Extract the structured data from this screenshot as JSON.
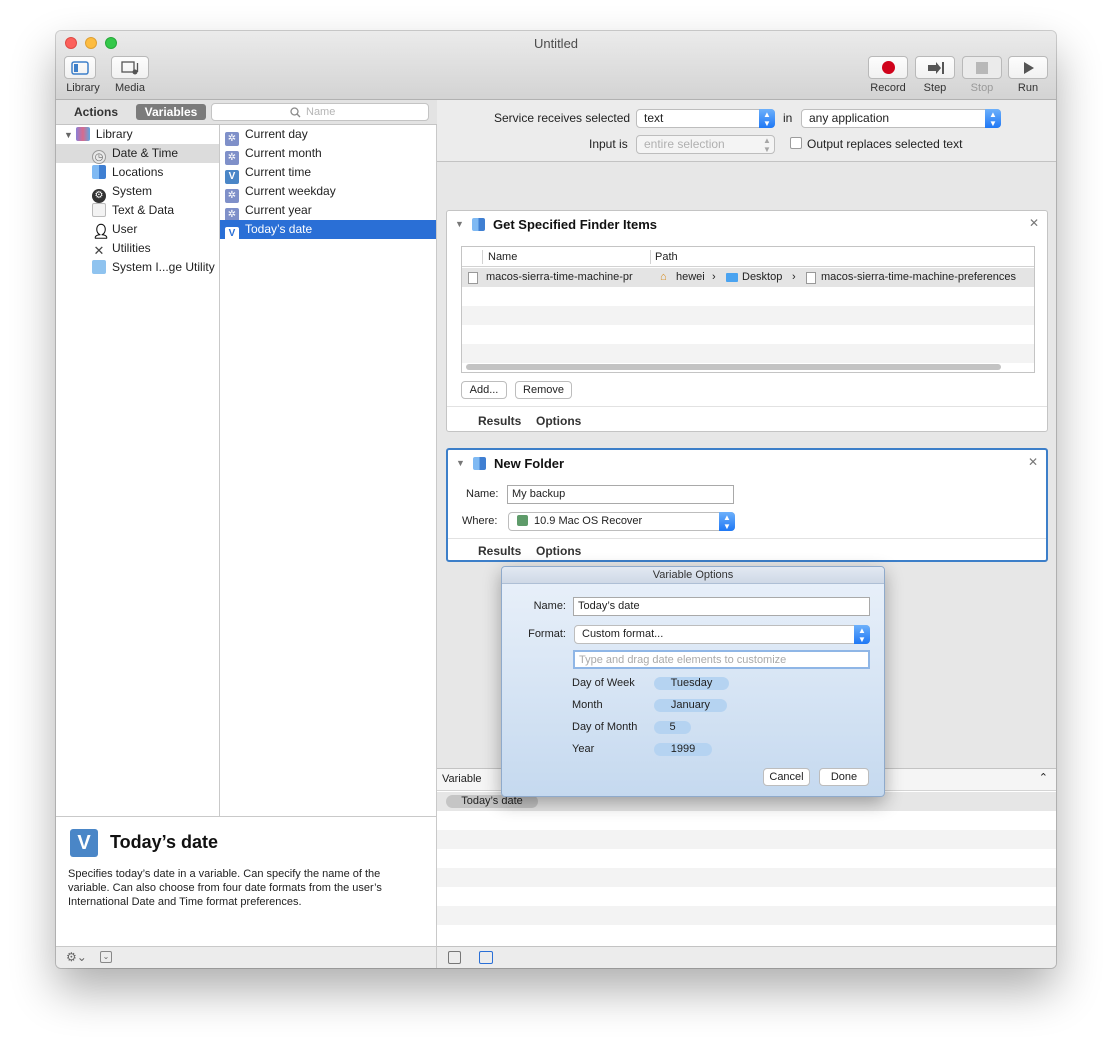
{
  "window": {
    "title": "Untitled"
  },
  "toolbar": {
    "library": "Library",
    "media": "Media",
    "record": "Record",
    "step": "Step",
    "stop": "Stop",
    "run": "Run"
  },
  "sidebar": {
    "tab_actions": "Actions",
    "tab_variables": "Variables",
    "search_placeholder": "Name",
    "library_root": "Library",
    "categories": [
      {
        "label": "Date & Time",
        "icon": "clock-icon"
      },
      {
        "label": "Locations",
        "icon": "finder-icon"
      },
      {
        "label": "System",
        "icon": "system-icon"
      },
      {
        "label": "Text & Data",
        "icon": "text-icon"
      },
      {
        "label": "User",
        "icon": "user-icon"
      },
      {
        "label": "Utilities",
        "icon": "utilities-icon"
      },
      {
        "label": "System I...ge Utility",
        "icon": "image-utility-icon"
      }
    ],
    "variables": [
      {
        "label": "Current day",
        "icon": "gear-icon"
      },
      {
        "label": "Current month",
        "icon": "gear-icon"
      },
      {
        "label": "Current time",
        "icon": "variable-v-icon"
      },
      {
        "label": "Current weekday",
        "icon": "gear-icon"
      },
      {
        "label": "Current year",
        "icon": "gear-icon"
      },
      {
        "label": "Today’s date",
        "icon": "variable-v-icon"
      }
    ]
  },
  "description": {
    "icon_letter": "V",
    "title": "Today’s date",
    "text": "Specifies today’s date in a variable. Can specify the name of the variable. Can also choose from four date formats from the user’s International Date and Time format preferences."
  },
  "workflow_header": {
    "receives_label": "Service receives selected",
    "receives_value": "text",
    "in_label": "in",
    "in_value": "any application",
    "input_is_label": "Input is",
    "input_is_value": "entire selection",
    "output_replaces_label": "Output replaces selected text"
  },
  "action1": {
    "title": "Get Specified Finder Items",
    "col_name": "Name",
    "col_path": "Path",
    "row_name": "macos-sierra-time-machine-pr",
    "path_home": "hewei",
    "path_desktop": "Desktop",
    "path_file": "macos-sierra-time-machine-preferences",
    "add_button": "Add...",
    "remove_button": "Remove",
    "results": "Results",
    "options": "Options"
  },
  "action2": {
    "title": "New Folder",
    "name_label": "Name:",
    "name_value": "My backup",
    "where_label": "Where:",
    "where_value": "10.9 Mac OS Recover",
    "results": "Results",
    "options": "Options"
  },
  "variables_section": {
    "header": "Variable",
    "items": [
      "Today’s date"
    ]
  },
  "sheet": {
    "title": "Variable Options",
    "name_label": "Name:",
    "name_value": "Today’s date",
    "format_label": "Format:",
    "format_value": "Custom format...",
    "custom_placeholder": "Type and drag date elements to customize",
    "elements": [
      {
        "label": "Day of Week",
        "token": "Tuesday"
      },
      {
        "label": "Month",
        "token": "January"
      },
      {
        "label": "Day of Month",
        "token": "5"
      },
      {
        "label": "Year",
        "token": "1999"
      }
    ],
    "cancel": "Cancel",
    "done": "Done"
  },
  "colors": {
    "accent": "#1f78f5",
    "selection": "#2a6fd6",
    "record": "#d0021b"
  }
}
